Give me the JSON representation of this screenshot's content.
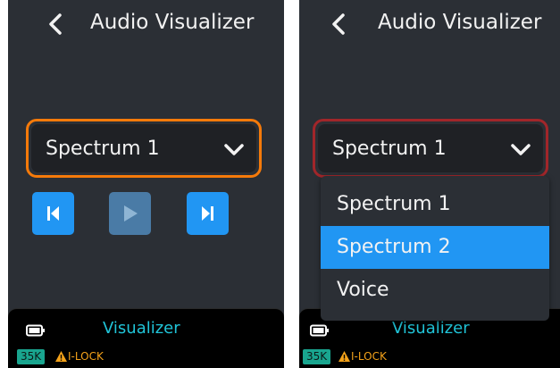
{
  "header": {
    "title": "Audio Visualizer"
  },
  "left_screen": {
    "select": {
      "value": "Spectrum 1"
    },
    "controls": [
      "previous",
      "play",
      "next"
    ]
  },
  "right_screen": {
    "select": {
      "value": "Spectrum 1"
    },
    "dropdown": {
      "options": [
        "Spectrum 1",
        "Spectrum 2",
        "Voice"
      ],
      "highlighted": "Spectrum 2"
    }
  },
  "status_bar": {
    "title": "Visualizer",
    "badge": "35K",
    "lock": "I-LOCK"
  },
  "colors": {
    "focus_border": "#f57a0a",
    "open_border": "#a1262a",
    "accent_blue": "#2196f3",
    "status_cyan": "#20c4d8",
    "badge_green": "#19a58f",
    "warning_yellow": "#f3a21a"
  },
  "icons": [
    "back-icon",
    "chevron-down-icon",
    "skip-previous-icon",
    "play-icon",
    "skip-next-icon",
    "battery-icon",
    "warning-icon"
  ]
}
